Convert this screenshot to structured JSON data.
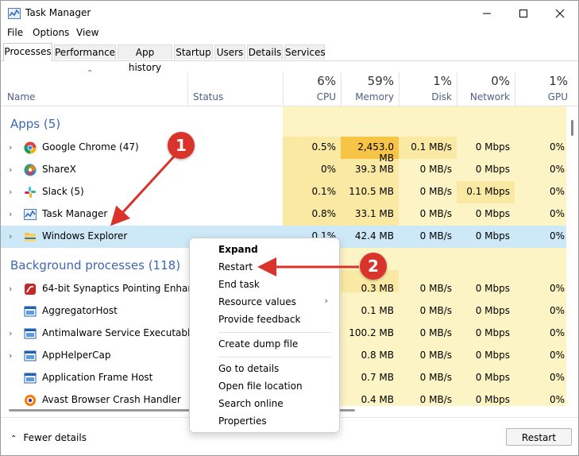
{
  "window": {
    "title": "Task Manager",
    "icon": "task-manager-icon",
    "buttons": [
      "minimize-icon",
      "maximize-icon",
      "close-icon"
    ]
  },
  "menu": [
    "File",
    "Options",
    "View"
  ],
  "tabs": [
    "Processes",
    "Performance",
    "App history",
    "Startup",
    "Users",
    "Details",
    "Services"
  ],
  "columns": {
    "name": "Name",
    "status": "Status",
    "cpu": {
      "pct": "6%",
      "label": "CPU"
    },
    "memory": {
      "pct": "59%",
      "label": "Memory"
    },
    "disk": {
      "pct": "1%",
      "label": "Disk"
    },
    "network": {
      "pct": "0%",
      "label": "Network"
    },
    "gpu": {
      "pct": "1%",
      "label": "GPU"
    }
  },
  "groups": {
    "apps": "Apps (5)",
    "background": "Background processes (118)"
  },
  "apps": [
    {
      "name": "Google Chrome (47)",
      "icon": "chrome-icon",
      "cpu": "0.5%",
      "memory": "2,453.0 MB",
      "disk": "0.1 MB/s",
      "network": "0 Mbps",
      "gpu": "0%"
    },
    {
      "name": "ShareX",
      "icon": "sharex-icon",
      "cpu": "0%",
      "memory": "39.3 MB",
      "disk": "0 MB/s",
      "network": "0 Mbps",
      "gpu": "0%"
    },
    {
      "name": "Slack (5)",
      "icon": "slack-icon",
      "cpu": "0.1%",
      "memory": "110.5 MB",
      "disk": "0 MB/s",
      "network": "0.1 Mbps",
      "gpu": "0%"
    },
    {
      "name": "Task Manager",
      "icon": "task-manager-icon",
      "cpu": "0.8%",
      "memory": "33.1 MB",
      "disk": "0 MB/s",
      "network": "0 Mbps",
      "gpu": "0%"
    },
    {
      "name": "Windows Explorer",
      "icon": "folder-icon",
      "cpu": "0.1%",
      "memory": "42.4 MB",
      "disk": "0 MB/s",
      "network": "0 Mbps",
      "gpu": "0%"
    }
  ],
  "background": [
    {
      "name": "64-bit Synaptics Pointing Enhan...",
      "icon": "synaptics-icon",
      "memory": "0.3 MB",
      "disk": "0 MB/s",
      "network": "0 Mbps",
      "gpu": "0%"
    },
    {
      "name": "AggregatorHost",
      "icon": "app-window-icon",
      "memory": "0.1 MB",
      "disk": "0 MB/s",
      "network": "0 Mbps",
      "gpu": "0%"
    },
    {
      "name": "Antimalware Service Executable",
      "icon": "app-window-icon",
      "memory": "100.2 MB",
      "disk": "0 MB/s",
      "network": "0 Mbps",
      "gpu": "0%"
    },
    {
      "name": "AppHelperCap",
      "icon": "app-window-icon",
      "memory": "0.8 MB",
      "disk": "0 MB/s",
      "network": "0 Mbps",
      "gpu": "0%"
    },
    {
      "name": "Application Frame Host",
      "icon": "app-window-icon",
      "memory": "0.7 MB",
      "disk": "0 MB/s",
      "network": "0 Mbps",
      "gpu": "0%"
    },
    {
      "name": "Avast Browser Crash Handler",
      "icon": "avast-icon",
      "memory": "0.4 MB",
      "disk": "0 MB/s",
      "network": "0 Mbps",
      "gpu": "0%"
    }
  ],
  "context_menu": {
    "expand": "Expand",
    "restart": "Restart",
    "end_task": "End task",
    "resource_values": "Resource values",
    "provide_feedback": "Provide feedback",
    "create_dump": "Create dump file",
    "go_to_details": "Go to details",
    "open_file_location": "Open file location",
    "search_online": "Search online",
    "properties": "Properties"
  },
  "footer": {
    "fewer_details": "Fewer details",
    "restart_button": "Restart"
  },
  "annotations": {
    "badge1": "1",
    "badge2": "2"
  },
  "colors": {
    "heat_light": "#fdf4c5",
    "heat_mid": "#fae9a3",
    "heat_high": "#f6c447",
    "selection": "#cde8f7",
    "annotation_red": "#d9332c",
    "group_blue": "#3d67b3"
  }
}
